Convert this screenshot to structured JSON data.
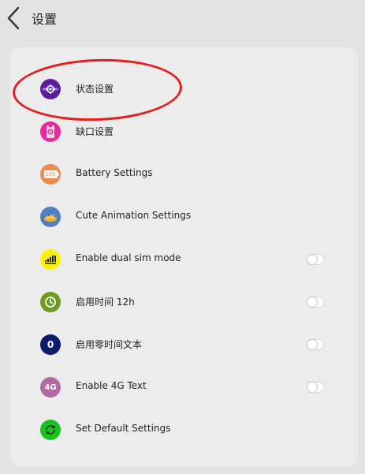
{
  "header": {
    "title": "设置"
  },
  "settings": [
    {
      "label": "状态设置",
      "icon": "statusbar-settings-icon",
      "color": "#5b1e98"
    },
    {
      "label": "缺口设置",
      "icon": "notch-settings-icon",
      "color": "#e8299c"
    },
    {
      "label": "Battery Settings",
      "icon": "battery-icon",
      "color": "#f0894f",
      "badge": "100"
    },
    {
      "label": "Cute Animation Settings",
      "icon": "animation-icon",
      "color": "#4f80c2"
    },
    {
      "label": "Enable dual sim mode",
      "icon": "dual-sim-signal-icon",
      "color": "#fff200",
      "toggle": false
    },
    {
      "label": "启用时间 12h",
      "icon": "clock-icon",
      "color": "#6e9a21",
      "toggle": false
    },
    {
      "label": "启用零时间文本",
      "icon": "zero-time-icon",
      "color": "#0c1c6a",
      "glyph": "0",
      "toggle": false
    },
    {
      "label": "Enable 4G Text",
      "icon": "4g-text-icon",
      "color": "#b06aa4",
      "glyph": "4G",
      "toggle": false
    },
    {
      "label": "Set Default Settings",
      "icon": "reset-default-icon",
      "color": "#19c222"
    }
  ]
}
